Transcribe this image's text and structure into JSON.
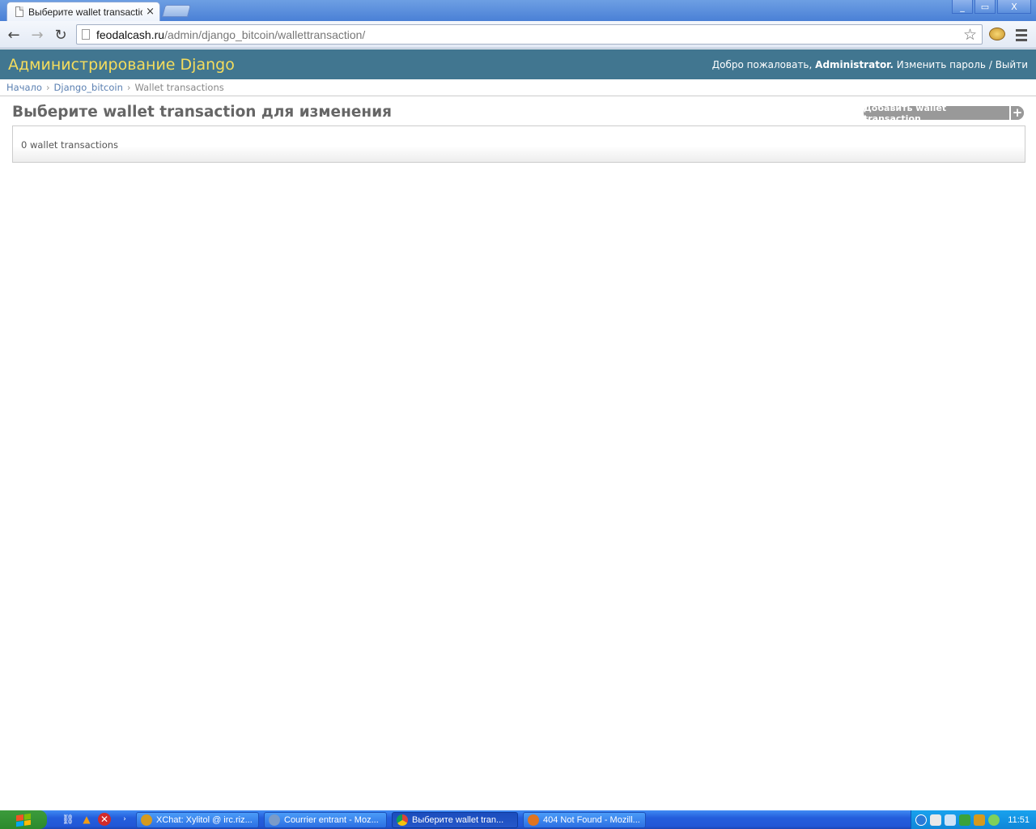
{
  "browser": {
    "tab_title": "Выберите wallet transaction",
    "tab_close": "×",
    "url_host": "feodalcash.ru",
    "url_path": "/admin/django_bitcoin/wallettransaction/",
    "window_controls": {
      "minimize": "_",
      "restore": "▭",
      "close": "X"
    },
    "nav": {
      "back": "←",
      "forward": "→",
      "reload": "↻"
    },
    "star": "☆"
  },
  "header": {
    "branding": "Администрирование Django",
    "welcome": "Добро пожаловать,",
    "username": "Administrator",
    "change_password": "Изменить пароль",
    "separator": "/",
    "logout": "Выйти"
  },
  "breadcrumbs": {
    "home": "Начало",
    "app": "Django_bitcoin",
    "current": "Wallet transactions",
    "sep": "›"
  },
  "content": {
    "title": "Выберите wallet transaction для изменения",
    "add_button": "Добавить wallet transaction",
    "add_plus": "+",
    "result_count": "0 wallet transactions"
  },
  "taskbar": {
    "tasks": [
      {
        "label": "XChat: Xylitol @ irc.riz...",
        "color": "#d69a1e"
      },
      {
        "label": "Courrier entrant - Moz...",
        "color": "#7a9bc9"
      },
      {
        "label": "Выберите wallet tran...",
        "color": "#3a9c48"
      },
      {
        "label": "404 Not Found - Mozill...",
        "color": "#e07420"
      }
    ],
    "active_task": 2,
    "clock": "11:51"
  }
}
